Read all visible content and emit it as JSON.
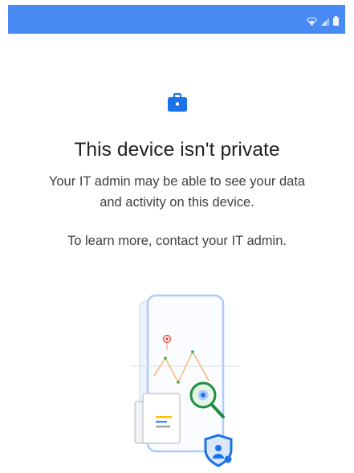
{
  "status_bar": {
    "background": "#4a8af4",
    "icons": [
      "wifi-icon",
      "signal-icon",
      "battery-icon"
    ]
  },
  "main": {
    "icon": "briefcase-icon",
    "title": "This device isn't private",
    "subtitle": "Your IT admin may be able to see your data and activity on this device.",
    "learn_more": "To learn more, contact your IT admin.",
    "illustration": "device-monitoring-illustration"
  },
  "colors": {
    "accent": "#1a73e8",
    "title_text": "#202124",
    "body_text": "#3c4043",
    "magnifier": "#1e8e3e"
  }
}
